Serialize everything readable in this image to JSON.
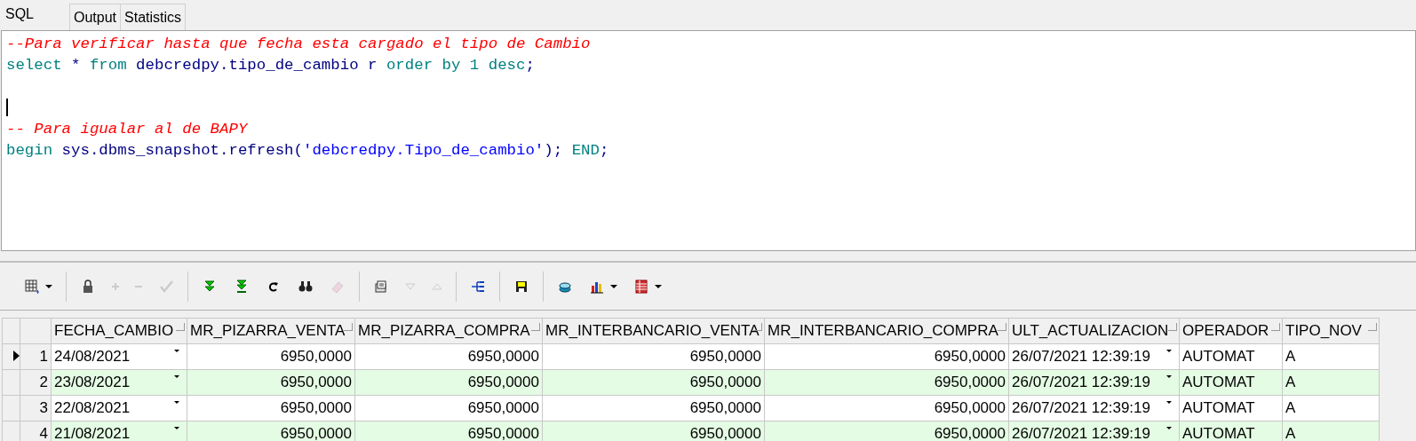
{
  "tabs": [
    {
      "label": "SQL",
      "selected": true
    },
    {
      "label": "Output",
      "selected": false
    },
    {
      "label": "Statistics",
      "selected": false
    }
  ],
  "editor": {
    "lines": [
      {
        "kind": "code",
        "tokens": [
          {
            "text": "--Para verificar hasta que fecha esta cargado el tipo de Cambio",
            "kind": "comment"
          }
        ]
      },
      {
        "kind": "code",
        "tokens": [
          {
            "text": "select",
            "kind": "keyword"
          },
          {
            "text": " * ",
            "kind": "ident"
          },
          {
            "text": "from",
            "kind": "keyword"
          },
          {
            "text": " debcredpy.tipo_de_cambio r ",
            "kind": "ident"
          },
          {
            "text": "order by",
            "kind": "keyword"
          },
          {
            "text": " 1 ",
            "kind": "number"
          },
          {
            "text": "desc",
            "kind": "keyword"
          },
          {
            "text": ";",
            "kind": "ident"
          }
        ]
      },
      {
        "kind": "blank"
      },
      {
        "kind": "blank",
        "caret": true
      },
      {
        "kind": "code",
        "tokens": [
          {
            "text": "-- Para igualar al de BAPY",
            "kind": "comment"
          }
        ]
      },
      {
        "kind": "code",
        "tokens": [
          {
            "text": "begin",
            "kind": "keyword"
          },
          {
            "text": " sys.dbms_snapshot.refresh(",
            "kind": "ident"
          },
          {
            "text": "'debcredpy.Tipo_de_cambio'",
            "kind": "string"
          },
          {
            "text": "); ",
            "kind": "ident"
          },
          {
            "text": "END",
            "kind": "keyword"
          },
          {
            "text": ";",
            "kind": "ident"
          }
        ]
      }
    ]
  },
  "toolbar": [
    {
      "kind": "grid",
      "disabled": false,
      "dropdown": true
    },
    {
      "kind": "sep"
    },
    {
      "kind": "lock",
      "disabled": false,
      "dropdown": false
    },
    {
      "kind": "plus",
      "disabled": true,
      "dropdown": false
    },
    {
      "kind": "minus",
      "disabled": true,
      "dropdown": false
    },
    {
      "kind": "check",
      "disabled": true,
      "dropdown": false
    },
    {
      "kind": "sep"
    },
    {
      "kind": "next",
      "disabled": false,
      "dropdown": false
    },
    {
      "kind": "last",
      "disabled": false,
      "dropdown": false
    },
    {
      "kind": "refresh",
      "disabled": false,
      "dropdown": false
    },
    {
      "kind": "find",
      "disabled": false,
      "dropdown": false
    },
    {
      "kind": "eraser",
      "disabled": true,
      "dropdown": false
    },
    {
      "kind": "sep"
    },
    {
      "kind": "notes",
      "disabled": false,
      "dropdown": false
    },
    {
      "kind": "down",
      "disabled": true,
      "dropdown": false
    },
    {
      "kind": "up",
      "disabled": true,
      "dropdown": false
    },
    {
      "kind": "sep"
    },
    {
      "kind": "tree",
      "disabled": false,
      "dropdown": false
    },
    {
      "kind": "sep"
    },
    {
      "kind": "save",
      "disabled": false,
      "dropdown": false
    },
    {
      "kind": "sep"
    },
    {
      "kind": "db",
      "disabled": false,
      "dropdown": false
    },
    {
      "kind": "chart",
      "disabled": false,
      "dropdown": true
    },
    {
      "kind": "table",
      "disabled": false,
      "dropdown": true
    }
  ],
  "grid": {
    "columns": [
      {
        "label": "FECHA_CAMBIO",
        "kind": "date"
      },
      {
        "label": "MR_PIZARRA_VENTA",
        "kind": "number"
      },
      {
        "label": "MR_PIZARRA_COMPRA",
        "kind": "number"
      },
      {
        "label": "MR_INTERBANCARIO_VENTA",
        "kind": "number"
      },
      {
        "label": "MR_INTERBANCARIO_COMPRA",
        "kind": "number"
      },
      {
        "label": "ULT_ACTUALIZACION",
        "kind": "date"
      },
      {
        "label": "OPERADOR",
        "kind": "text"
      },
      {
        "label": "TIPO_NOV",
        "kind": "text"
      }
    ],
    "rows": [
      {
        "number": "1",
        "current": true,
        "cells": [
          "24/08/2021",
          "6950,0000",
          "6950,0000",
          "6950,0000",
          "6950,0000",
          "26/07/2021 12:39:19",
          "AUTOMAT",
          "A"
        ]
      },
      {
        "number": "2",
        "current": false,
        "cells": [
          "23/08/2021",
          "6950,0000",
          "6950,0000",
          "6950,0000",
          "6950,0000",
          "26/07/2021 12:39:19",
          "AUTOMAT",
          "A"
        ]
      },
      {
        "number": "3",
        "current": false,
        "cells": [
          "22/08/2021",
          "6950,0000",
          "6950,0000",
          "6950,0000",
          "6950,0000",
          "26/07/2021 12:39:19",
          "AUTOMAT",
          "A"
        ]
      },
      {
        "number": "4",
        "current": false,
        "cells": [
          "21/08/2021",
          "6950,0000",
          "6950,0000",
          "6950,0000",
          "6950,0000",
          "26/07/2021 12:39:19",
          "AUTOMAT",
          "A"
        ]
      }
    ]
  }
}
